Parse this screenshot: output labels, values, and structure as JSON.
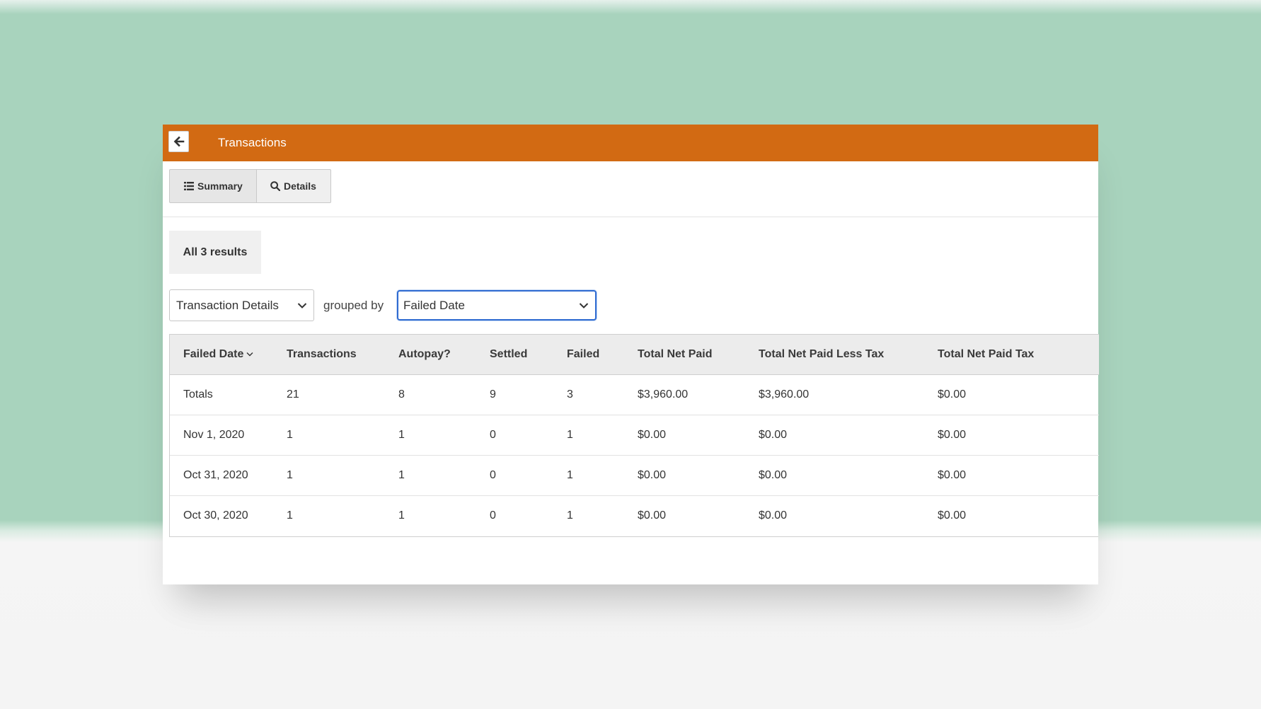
{
  "header": {
    "title": "Transactions"
  },
  "tabs": [
    {
      "label": "Summary",
      "icon": "list-icon"
    },
    {
      "label": "Details",
      "icon": "search-icon"
    }
  ],
  "results_label": "All 3 results",
  "report_select": {
    "value": "Transaction Details"
  },
  "grouped_by_label": "grouped by",
  "groupby_select": {
    "value": "Failed Date"
  },
  "table": {
    "columns": [
      "Failed Date",
      "Transactions",
      "Autopay?",
      "Settled",
      "Failed",
      "Total Net Paid",
      "Total Net Paid Less Tax",
      "Total Net Paid Tax"
    ],
    "rows": [
      [
        "Totals",
        "21",
        "8",
        "9",
        "3",
        "$3,960.00",
        "$3,960.00",
        "$0.00"
      ],
      [
        "Nov 1, 2020",
        "1",
        "1",
        "0",
        "1",
        "$0.00",
        "$0.00",
        "$0.00"
      ],
      [
        "Oct 31, 2020",
        "1",
        "1",
        "0",
        "1",
        "$0.00",
        "$0.00",
        "$0.00"
      ],
      [
        "Oct 30, 2020",
        "1",
        "1",
        "0",
        "1",
        "$0.00",
        "$0.00",
        "$0.00"
      ]
    ]
  },
  "colors": {
    "header": "#d26a13",
    "background": "#a8d3bd",
    "focus": "#2f6bd1"
  }
}
